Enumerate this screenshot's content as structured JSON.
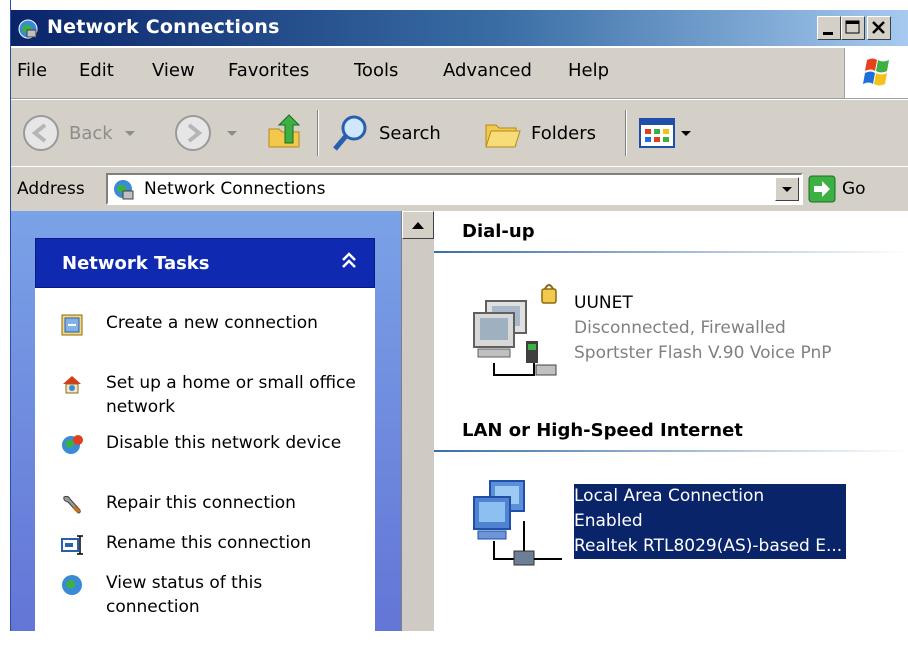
{
  "window": {
    "title": "Network Connections"
  },
  "menu": [
    "File",
    "Edit",
    "View",
    "Favorites",
    "Tools",
    "Advanced",
    "Help"
  ],
  "toolbar": {
    "back": "Back",
    "search": "Search",
    "folders": "Folders"
  },
  "address": {
    "label": "Address",
    "value": "Network Connections",
    "go": "Go"
  },
  "tasks": {
    "title": "Network Tasks",
    "items": [
      "Create a new connection",
      "Set up a home or small office network",
      "Disable this network device",
      "Repair this connection",
      "Rename this connection",
      "View status of this connection"
    ]
  },
  "groups": {
    "dialup": {
      "title": "Dial-up",
      "name": "UUNET",
      "status": "Disconnected, Firewalled",
      "device": "Sportster Flash V.90 Voice PnP"
    },
    "lan": {
      "title": "LAN or High-Speed Internet",
      "name": "Local Area Connection",
      "status": "Enabled",
      "device": "Realtek RTL8029(AS)-based E..."
    }
  },
  "colors": {
    "title_bar": "#0a246a",
    "panel_header": "#0f2ab0",
    "selection": "#0a246a",
    "left_pane": "#6f8ce0"
  }
}
